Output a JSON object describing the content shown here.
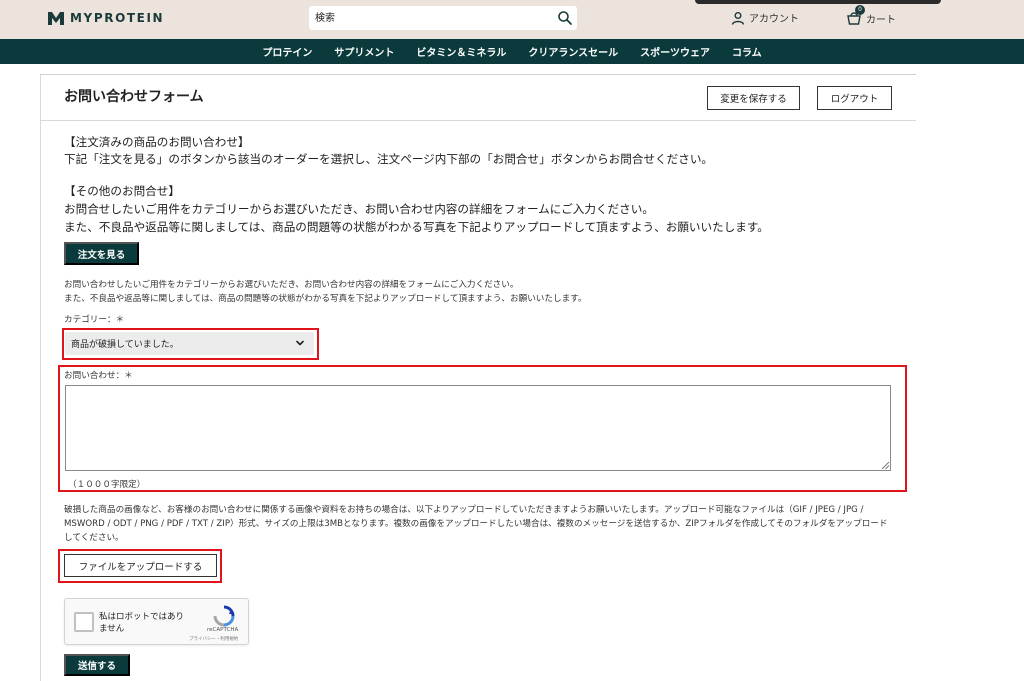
{
  "header": {
    "logo_text": "MYPROTEIN",
    "search_placeholder": "検索",
    "account_label": "アカウント",
    "cart_label": "カート",
    "cart_count": "0"
  },
  "nav": {
    "items": [
      "プロテイン",
      "サプリメント",
      "ビタミン＆ミネラル",
      "クリアランスセール",
      "スポーツウェア",
      "コラム"
    ]
  },
  "page": {
    "title": "お問い合わせフォーム",
    "save_button": "変更を保存する",
    "logout_button": "ログアウト"
  },
  "intro": {
    "ordered_heading": "【注文済みの商品のお問い合わせ】",
    "ordered_text": "下記「注文を見る」のボタンから該当のオーダーを選択し、注文ページ内下部の「お問合せ」ボタンからお問合せください。",
    "other_heading": "【その他のお問合せ】",
    "other_text1": "お問合せしたいご用件をカテゴリーからお選びいただき、お問い合わせ内容の詳細をフォームにご入力ください。",
    "other_text2": "また、不良品や返品等に関しましては、商品の問題等の状態がわかる写真を下記よりアップロードして頂ますよう、お願いいたします。",
    "view_orders_button": "注文を見る"
  },
  "form": {
    "note1": "お問い合わせしたいご用件をカテゴリーからお選びいただき、お問い合わせ内容の詳細をフォームにご入力ください。",
    "note2": "また、不良品や返品等に関しましては、商品の問題等の状態がわかる写真を下記よりアップロードして頂ますよう、お願いいたします。",
    "category_label": "カテゴリー：＊",
    "category_value": "商品が破損していました。",
    "inquiry_label": "お問い合わせ：＊",
    "inquiry_value": "",
    "char_limit": "（１０００字限定）",
    "upload_text": "破損した商品の画像など、お客様のお問い合わせに関係する画像や資料をお持ちの場合は、以下よりアップロードしていただきますようお願いいたします。アップロード可能なファイルは（GIF / JPEG / JPG / MSWORD / ODT / PNG / PDF / TXT / ZIP）形式、サイズの上限は3MBとなります。複数の画像をアップロードしたい場合は、複数のメッセージを送信するか、ZIPフォルダを作成してそのフォルダをアップロードしてください。",
    "upload_button": "ファイルをアップロードする",
    "submit_button": "送信する"
  },
  "captcha": {
    "label": "私はロボットではありません",
    "brand": "reCAPTCHA",
    "links": "プライバシー・利用規約"
  },
  "colors": {
    "brand_dark": "#0b3a3d",
    "header_bg": "#ece3dc",
    "highlight": "#e0141b"
  }
}
